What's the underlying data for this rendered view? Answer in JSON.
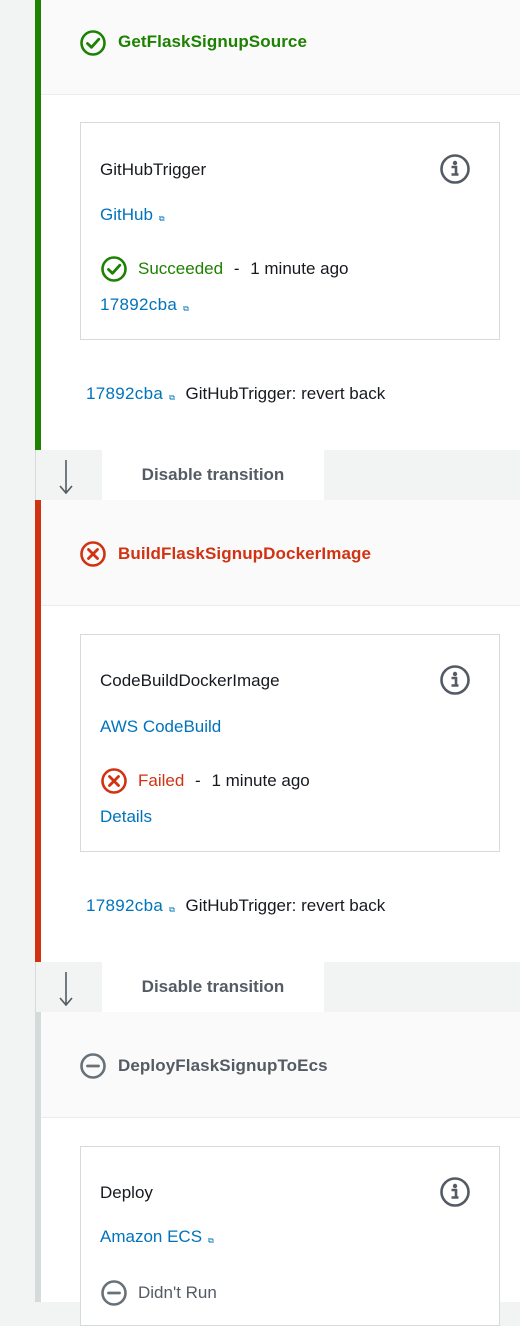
{
  "colors": {
    "success": "#1d8102",
    "failed": "#d13212",
    "neutral": "#687078",
    "link": "#0073bb"
  },
  "stages": [
    {
      "name": "GetFlaskSignupSource",
      "status": "succeeded",
      "status_icon": "check-circle-icon",
      "action": {
        "name": "GitHubTrigger",
        "provider": "GitHub",
        "status_label": "Succeeded",
        "separator": "-",
        "time": "1 minute ago",
        "sub_link": "17892cba"
      },
      "commit": {
        "id": "17892cba",
        "message": "GitHubTrigger: revert back"
      }
    },
    {
      "name": "BuildFlaskSignupDockerImage",
      "status": "failed",
      "status_icon": "x-circle-icon",
      "action": {
        "name": "CodeBuildDockerImage",
        "provider": "AWS CodeBuild",
        "status_label": "Failed",
        "separator": "-",
        "time": "1 minute ago",
        "sub_link": "Details"
      },
      "commit": {
        "id": "17892cba",
        "message": "GitHubTrigger: revert back"
      }
    },
    {
      "name": "DeployFlaskSignupToEcs",
      "status": "not-run",
      "status_icon": "minus-circle-icon",
      "action": {
        "name": "Deploy",
        "provider": "Amazon ECS",
        "status_label": "Didn't Run"
      }
    }
  ],
  "transitions": [
    {
      "label": "Disable transition"
    },
    {
      "label": "Disable transition"
    }
  ]
}
